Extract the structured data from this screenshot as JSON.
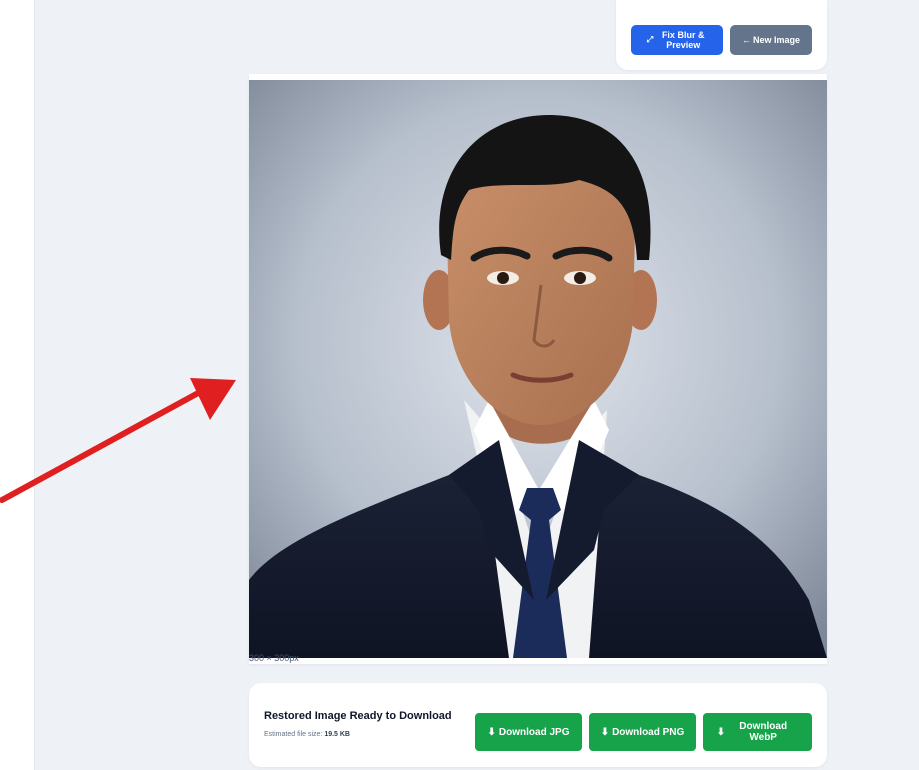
{
  "toolbar": {
    "fix_label": "Fix Blur & Preview",
    "fix_icon": "resize-arrows-icon",
    "new_label": "New Image",
    "new_icon": "arrow-left-icon"
  },
  "image": {
    "dimensions": "300 × 300px"
  },
  "download": {
    "title": "Restored Image Ready to Download",
    "size_label": "Estimated file size:",
    "size_value": "19.5 KB",
    "jpg_label": "Download JPG",
    "png_label": "Download PNG",
    "webp_label": "Download WebP",
    "download_icon": "download-arrow-icon"
  },
  "colors": {
    "primary": "#2563eb",
    "secondary": "#64748b",
    "success": "#16a34a",
    "annotation_arrow": "#e02020"
  }
}
